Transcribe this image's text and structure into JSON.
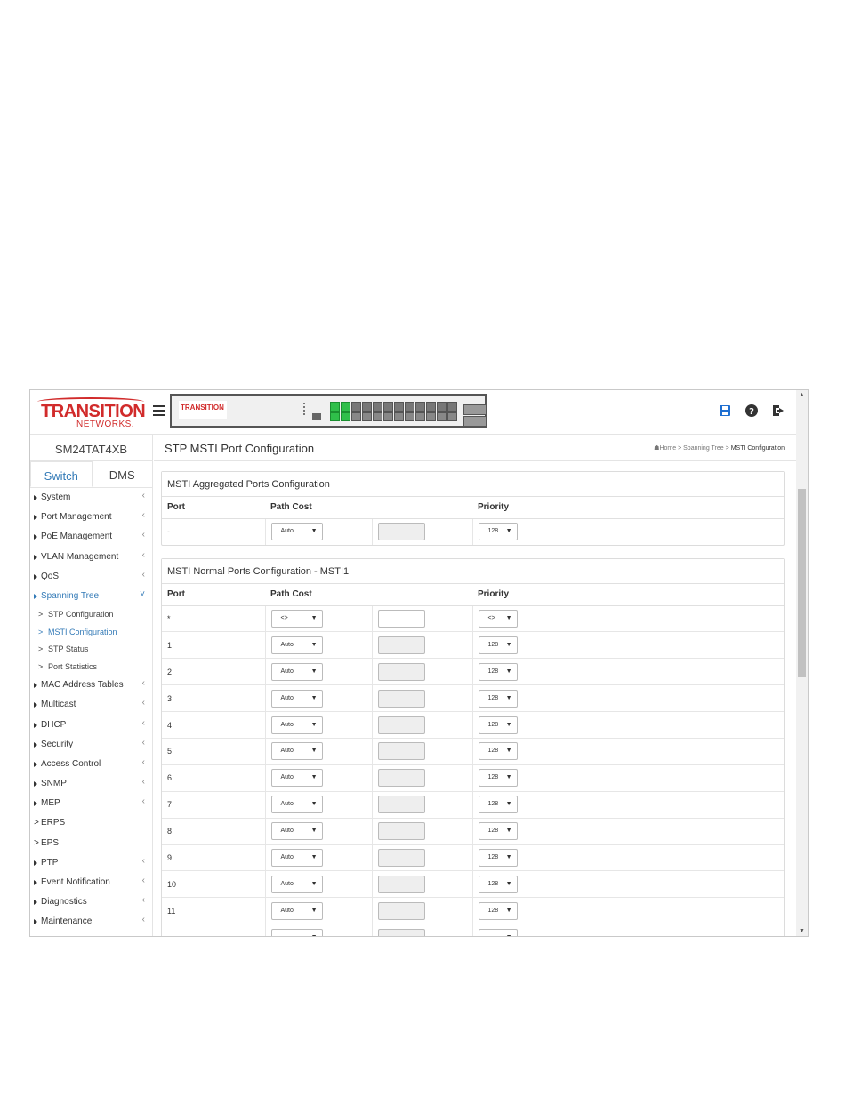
{
  "header": {
    "logo_line1": "TRANSITION",
    "logo_line2": "NETWORKS.",
    "device_logo": "TRANSITION",
    "port_numbers_top": [
      "1",
      "3",
      "5",
      "7",
      "9",
      "11",
      "13",
      "15",
      "17",
      "19",
      "21",
      "23",
      "25",
      "26"
    ],
    "port_numbers_bottom": [
      "2",
      "4",
      "6",
      "8",
      "10",
      "12",
      "14",
      "16",
      "18",
      "20",
      "22",
      "24",
      "25",
      "26"
    ],
    "up_ports": [
      1,
      2
    ],
    "icons": [
      "save-icon",
      "help-icon",
      "logout-icon"
    ]
  },
  "sidebar": {
    "model": "SM24TAT4XB",
    "tabs": [
      "Switch",
      "DMS"
    ],
    "active_tab": "Switch",
    "menu": [
      {
        "label": "System",
        "type": "caret",
        "arrow": "<"
      },
      {
        "label": "Port Management",
        "type": "caret",
        "arrow": "<"
      },
      {
        "label": "PoE Management",
        "type": "caret",
        "arrow": "<"
      },
      {
        "label": "VLAN Management",
        "type": "caret",
        "arrow": "<"
      },
      {
        "label": "QoS",
        "type": "caret",
        "arrow": "<"
      },
      {
        "label": "Spanning Tree",
        "type": "caret",
        "arrow": "v",
        "active": true
      },
      {
        "label": "MAC Address Tables",
        "type": "caret",
        "arrow": "<"
      },
      {
        "label": "Multicast",
        "type": "caret",
        "arrow": "<"
      },
      {
        "label": "DHCP",
        "type": "caret",
        "arrow": "<"
      },
      {
        "label": "Security",
        "type": "caret",
        "arrow": "<"
      },
      {
        "label": "Access Control",
        "type": "caret",
        "arrow": "<"
      },
      {
        "label": "SNMP",
        "type": "caret",
        "arrow": "<"
      },
      {
        "label": "MEP",
        "type": "caret",
        "arrow": "<"
      },
      {
        "label": "ERPS",
        "type": "gt",
        "arrow": ""
      },
      {
        "label": "EPS",
        "type": "gt",
        "arrow": ""
      },
      {
        "label": "PTP",
        "type": "caret",
        "arrow": "<"
      },
      {
        "label": "Event Notification",
        "type": "caret",
        "arrow": "<"
      },
      {
        "label": "Diagnostics",
        "type": "caret",
        "arrow": "<"
      },
      {
        "label": "Maintenance",
        "type": "caret",
        "arrow": "<"
      }
    ],
    "submenu": [
      {
        "label": "STP Configuration"
      },
      {
        "label": "MSTI Configuration",
        "active": true
      },
      {
        "label": "STP Status"
      },
      {
        "label": "Port Statistics"
      }
    ]
  },
  "main": {
    "title": "STP MSTI Port Configuration",
    "breadcrumb": {
      "home": "Home",
      "sep": ">",
      "parent": "Spanning Tree",
      "current": "MSTI Configuration"
    },
    "aggregated": {
      "title": "MSTI Aggregated Ports Configuration",
      "headers": {
        "port": "Port",
        "path_cost": "Path Cost",
        "priority": "Priority"
      },
      "row": {
        "port": "-",
        "path_cost": "Auto",
        "priority": "128"
      }
    },
    "normal": {
      "title": "MSTI Normal Ports Configuration - MSTI1",
      "headers": {
        "port": "Port",
        "path_cost": "Path Cost",
        "priority": "Priority"
      },
      "rows": [
        {
          "port": "*",
          "path_cost": "<>",
          "priority": "<>",
          "text_enabled": true
        },
        {
          "port": "1",
          "path_cost": "Auto",
          "priority": "128"
        },
        {
          "port": "2",
          "path_cost": "Auto",
          "priority": "128"
        },
        {
          "port": "3",
          "path_cost": "Auto",
          "priority": "128"
        },
        {
          "port": "4",
          "path_cost": "Auto",
          "priority": "128"
        },
        {
          "port": "5",
          "path_cost": "Auto",
          "priority": "128"
        },
        {
          "port": "6",
          "path_cost": "Auto",
          "priority": "128"
        },
        {
          "port": "7",
          "path_cost": "Auto",
          "priority": "128"
        },
        {
          "port": "8",
          "path_cost": "Auto",
          "priority": "128"
        },
        {
          "port": "9",
          "path_cost": "Auto",
          "priority": "128"
        },
        {
          "port": "10",
          "path_cost": "Auto",
          "priority": "128"
        },
        {
          "port": "11",
          "path_cost": "Auto",
          "priority": "128"
        },
        {
          "port": "",
          "path_cost": "",
          "priority": ""
        }
      ]
    }
  },
  "footer": {
    "link": ""
  }
}
